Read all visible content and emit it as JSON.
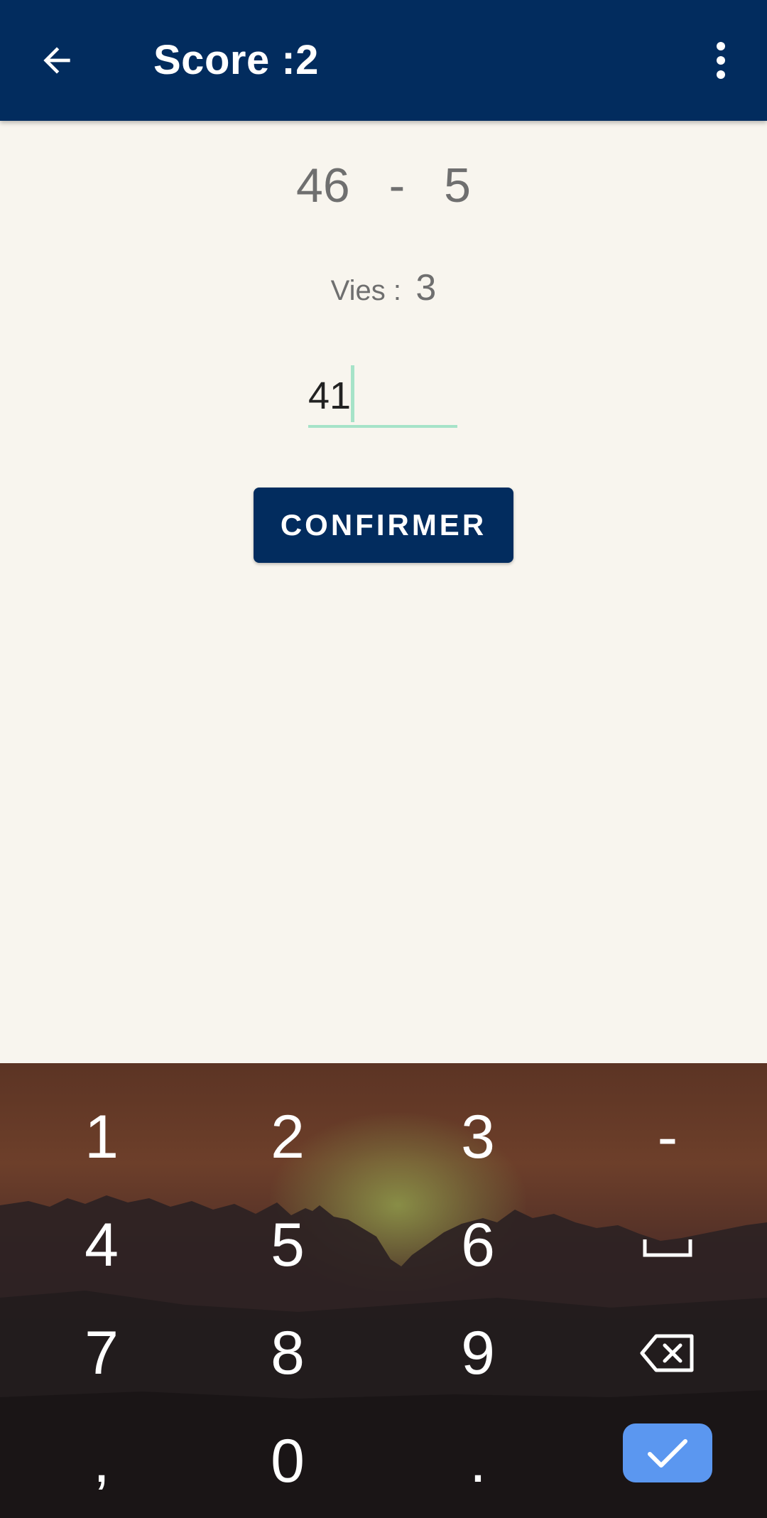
{
  "appbar": {
    "title": "Score :2",
    "back_icon": "arrow-left-icon",
    "menu_icon": "more-vert-icon",
    "background": "#022c5e"
  },
  "question": {
    "operand1": "46",
    "operator": "-",
    "operand2": "5"
  },
  "lives": {
    "label": "Vies :",
    "value": "3"
  },
  "answer": {
    "value": "41"
  },
  "confirm_button": {
    "label": "CONFIRMER"
  },
  "keyboard": {
    "keys": [
      "1",
      "2",
      "3",
      "-",
      "4",
      "5",
      "6",
      "7",
      "8",
      "9",
      ",",
      "0",
      "."
    ],
    "space_icon": "space-bar-icon",
    "backspace_icon": "backspace-icon",
    "enter_icon": "check-icon",
    "enter_color": "#5b97f0"
  }
}
